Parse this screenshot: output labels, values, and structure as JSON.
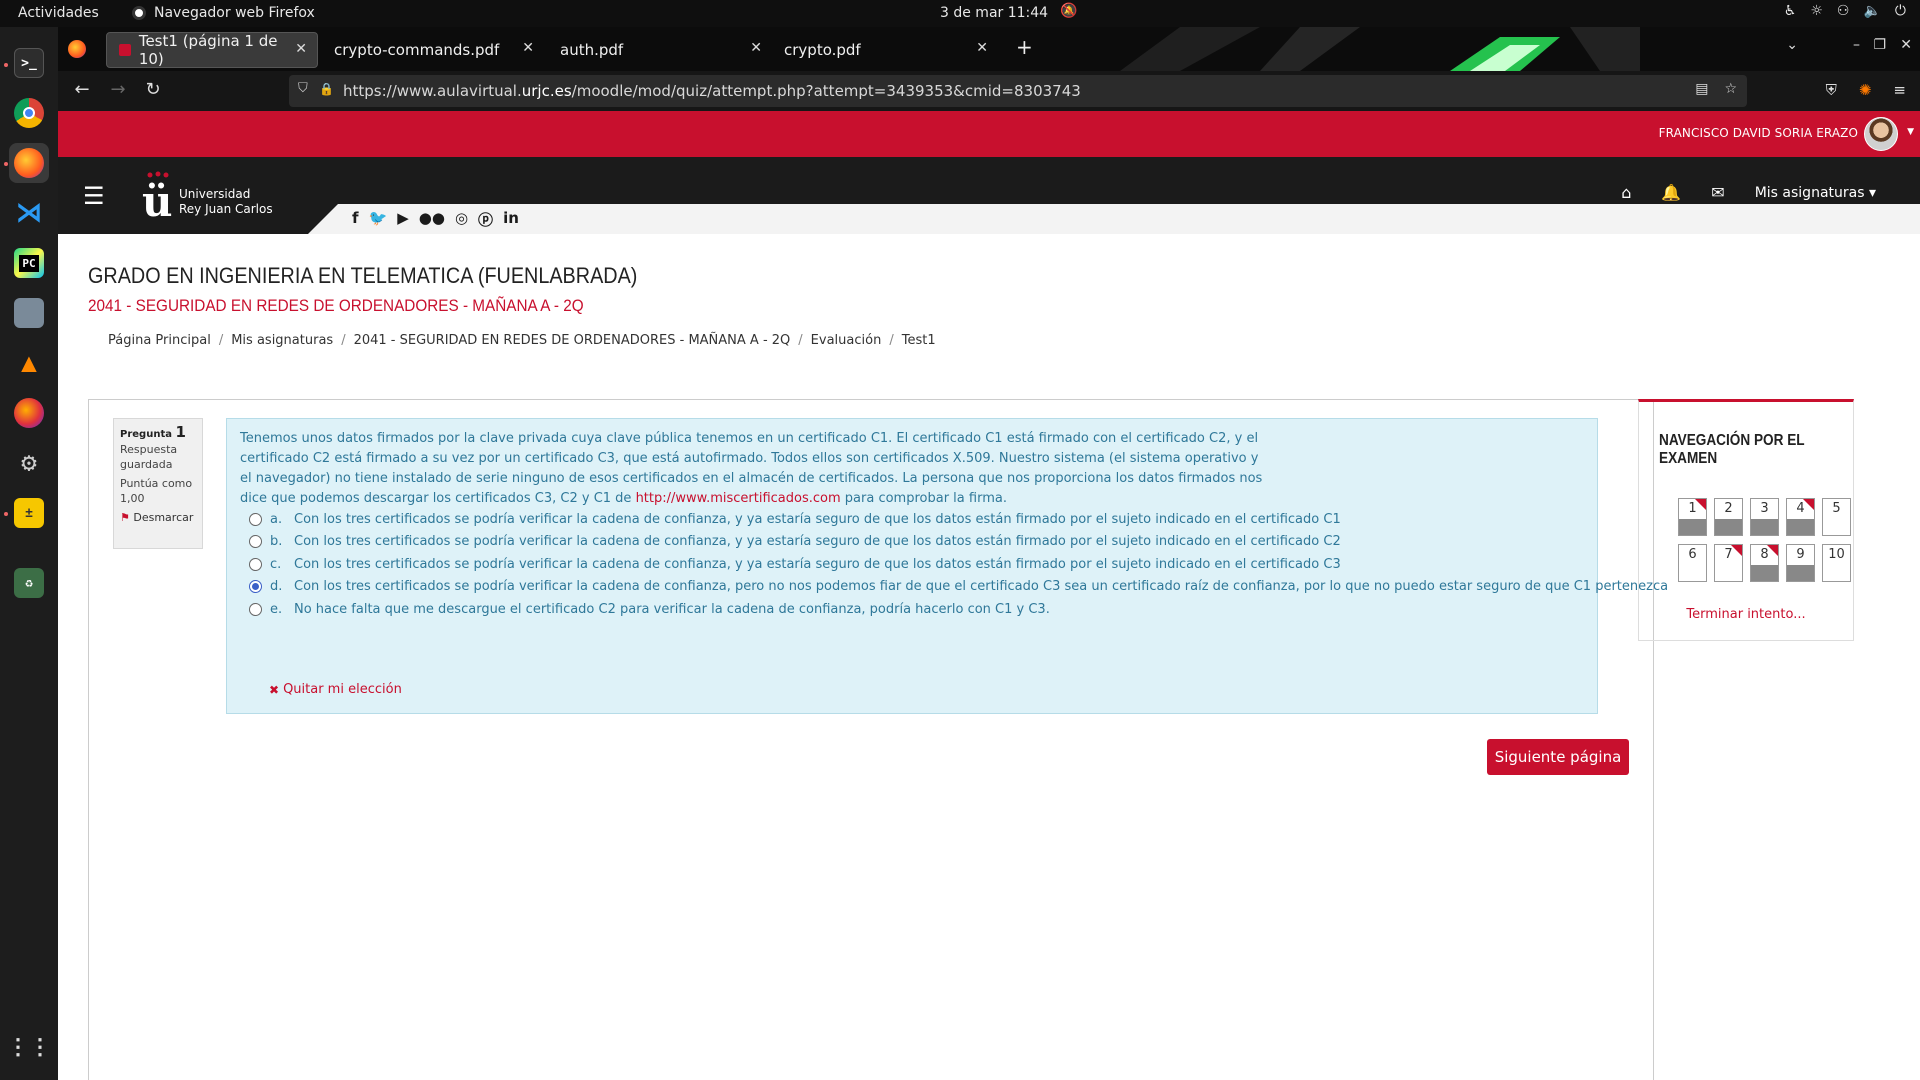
{
  "gnome": {
    "activities": "Actividades",
    "app_name": "Navegador web Firefox",
    "clock": "3 de mar  11:44",
    "icons": [
      "accessibility-icon",
      "brightness-icon",
      "network-icon",
      "volume-icon",
      "power-icon"
    ]
  },
  "dock": {
    "apps": [
      "terminal-icon",
      "chrome-icon",
      "firefox-icon",
      "vscode-icon",
      "pycharm-icon",
      "files-icon",
      "vlc-icon",
      "firefox-dev-icon",
      "settings-icon",
      "calculator-icon",
      "trash-icon",
      "app-grid-icon"
    ]
  },
  "tabs": [
    {
      "title": "Test1 (página 1 de 10)",
      "active": true
    },
    {
      "title": "crypto-commands.pdf",
      "active": false
    },
    {
      "title": "auth.pdf",
      "active": false
    },
    {
      "title": "crypto.pdf",
      "active": false
    }
  ],
  "url": {
    "prefix": "https://www.aulavirtual.",
    "domain": "urjc.es",
    "suffix": "/moodle/mod/quiz/attempt.php?attempt=3439353&cmid=8303743"
  },
  "header": {
    "user_name": "FRANCISCO DAVID SORIA ERAZO",
    "logo_line1": "Universidad",
    "logo_line2": "Rey Juan Carlos",
    "mis_asignaturas": "Mis asignaturas",
    "social": [
      "f",
      "t",
      "yt",
      "fl",
      "ig",
      "p",
      "in"
    ]
  },
  "course": {
    "title": "GRADO EN INGENIERIA EN TELEMATICA (FUENLABRADA)",
    "subtitle": "2041 - SEGURIDAD EN REDES DE ORDENADORES - MAÑANA A - 2Q"
  },
  "breadcrumb": [
    "Página Principal",
    "Mis asignaturas",
    "2041 - SEGURIDAD EN REDES DE ORDENADORES - MAÑANA A - 2Q",
    "Evaluación",
    "Test1"
  ],
  "question": {
    "label": "Pregunta",
    "number": "1",
    "status": "Respuesta guardada",
    "score": "Puntúa como 1,00",
    "flag": "Desmarcar",
    "text_1": "Tenemos unos datos firmados por la clave privada cuya clave pública tenemos en un certificado C1. El certificado C1 está firmado con el certificado C2, y el certificado C2 está firmado a su vez por un certificado C3, que está autofirmado. Todos ellos son certificados X.509. Nuestro sistema (el sistema operativo y el navegador) no tiene instalado de serie ninguno de esos certificados en el almacén de certificados. La persona que nos proporciona los datos firmados nos dice que podemos descargar los certificados C3, C2 y C1 de",
    "link": "http://www.miscertificados.com",
    "text_2": "para comprobar la firma.",
    "answers": [
      {
        "letter": "a.",
        "text": "Con los tres certificados se podría verificar la cadena de confianza, y ya estaría seguro de que los datos están firmado por el sujeto indicado en el certificado C1",
        "checked": false
      },
      {
        "letter": "b.",
        "text": "Con los tres certificados se podría verificar la cadena de confianza, y ya estaría seguro de que los datos están firmado por el sujeto indicado en el certificado C2",
        "checked": false
      },
      {
        "letter": "c.",
        "text": "Con los tres certificados se podría verificar la cadena de confianza, y ya estaría seguro de que los datos están firmado por el sujeto indicado en el certificado C3",
        "checked": false
      },
      {
        "letter": "d.",
        "text": "Con los tres certificados se podría verificar la cadena de confianza, pero no nos podemos fiar de que el certificado C3 sea un certificado raíz de confianza, por lo que no puedo estar seguro de que C1 pertenezca",
        "checked": true
      },
      {
        "letter": "e.",
        "text": "No hace falta que me descargue el certificado C2 para verificar la cadena de confianza, podría hacerlo con C1 y C3.",
        "checked": false
      }
    ],
    "clear_choice": "Quitar mi elección",
    "next_button": "Siguiente página"
  },
  "quiz_nav": {
    "title": "NAVEGACIÓN POR EL EXAMEN",
    "questions": [
      {
        "n": "1",
        "answered": true,
        "flagged": true
      },
      {
        "n": "2",
        "answered": true,
        "flagged": false
      },
      {
        "n": "3",
        "answered": true,
        "flagged": false
      },
      {
        "n": "4",
        "answered": true,
        "flagged": true
      },
      {
        "n": "5",
        "answered": false,
        "flagged": false
      },
      {
        "n": "6",
        "answered": false,
        "flagged": false
      },
      {
        "n": "7",
        "answered": false,
        "flagged": true
      },
      {
        "n": "8",
        "answered": true,
        "flagged": true
      },
      {
        "n": "9",
        "answered": true,
        "flagged": false
      },
      {
        "n": "10",
        "answered": false,
        "flagged": false
      }
    ],
    "finish": "Terminar intento..."
  },
  "colors": {
    "brand_red": "#c8102e",
    "question_bg": "#def2f8",
    "question_text": "#2f7899"
  }
}
